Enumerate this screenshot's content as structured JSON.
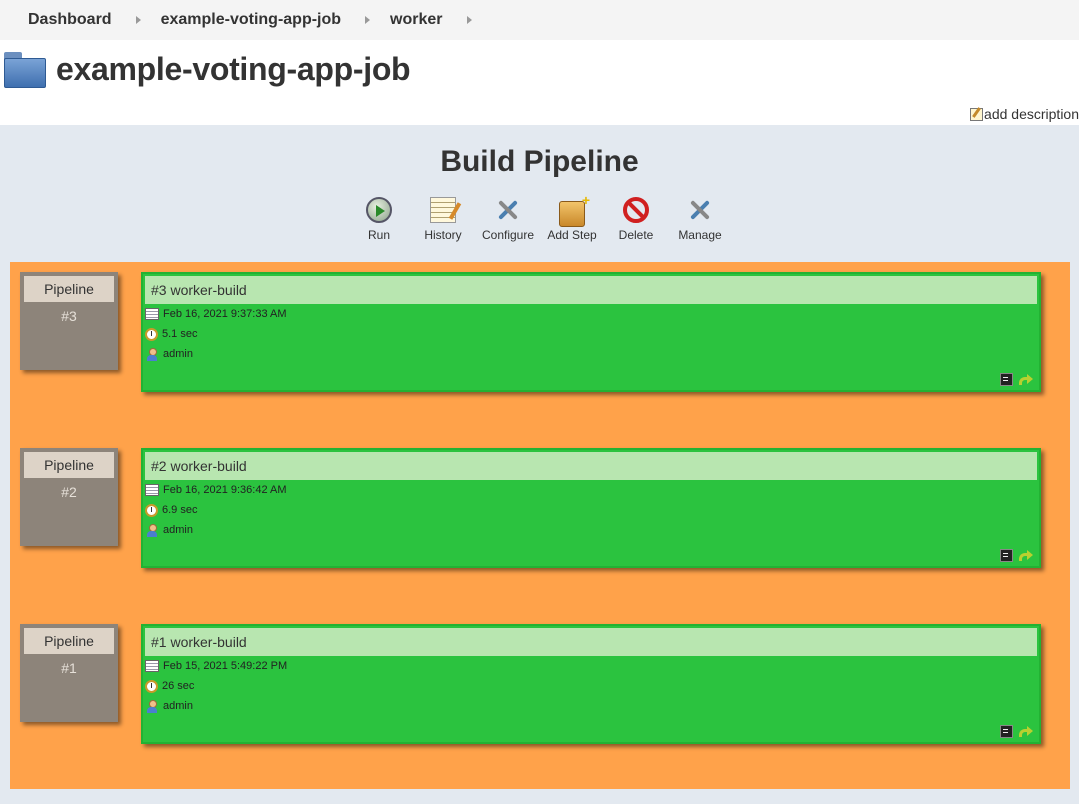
{
  "breadcrumb": [
    {
      "label": "Dashboard"
    },
    {
      "label": "example-voting-app-job"
    },
    {
      "label": "worker"
    }
  ],
  "page": {
    "title": "example-voting-app-job",
    "add_description": "add description"
  },
  "pipeline": {
    "title": "Build Pipeline",
    "toolbar": [
      {
        "label": "Run",
        "icon": "run-icon"
      },
      {
        "label": "History",
        "icon": "history-icon"
      },
      {
        "label": "Configure",
        "icon": "configure-icon"
      },
      {
        "label": "Add Step",
        "icon": "add-step-icon"
      },
      {
        "label": "Delete",
        "icon": "delete-icon"
      },
      {
        "label": "Manage",
        "icon": "manage-icon"
      }
    ],
    "rows": [
      {
        "pipeline_label": "Pipeline",
        "pipeline_num": "#3",
        "build_title": "#3 worker-build",
        "date": "Feb 16, 2021 9:37:33 AM",
        "duration": "5.1 sec",
        "user": "admin"
      },
      {
        "pipeline_label": "Pipeline",
        "pipeline_num": "#2",
        "build_title": "#2 worker-build",
        "date": "Feb 16, 2021 9:36:42 AM",
        "duration": "6.9 sec",
        "user": "admin"
      },
      {
        "pipeline_label": "Pipeline",
        "pipeline_num": "#1",
        "build_title": "#1 worker-build",
        "date": "Feb 15, 2021 5:49:22 PM",
        "duration": "26 sec",
        "user": "admin"
      }
    ],
    "colors": {
      "success": "#2bc33f",
      "header_bg": "#b8e6b0",
      "pipeline_area": "#ffa24a",
      "pipeline_box": "#8d847a"
    }
  }
}
